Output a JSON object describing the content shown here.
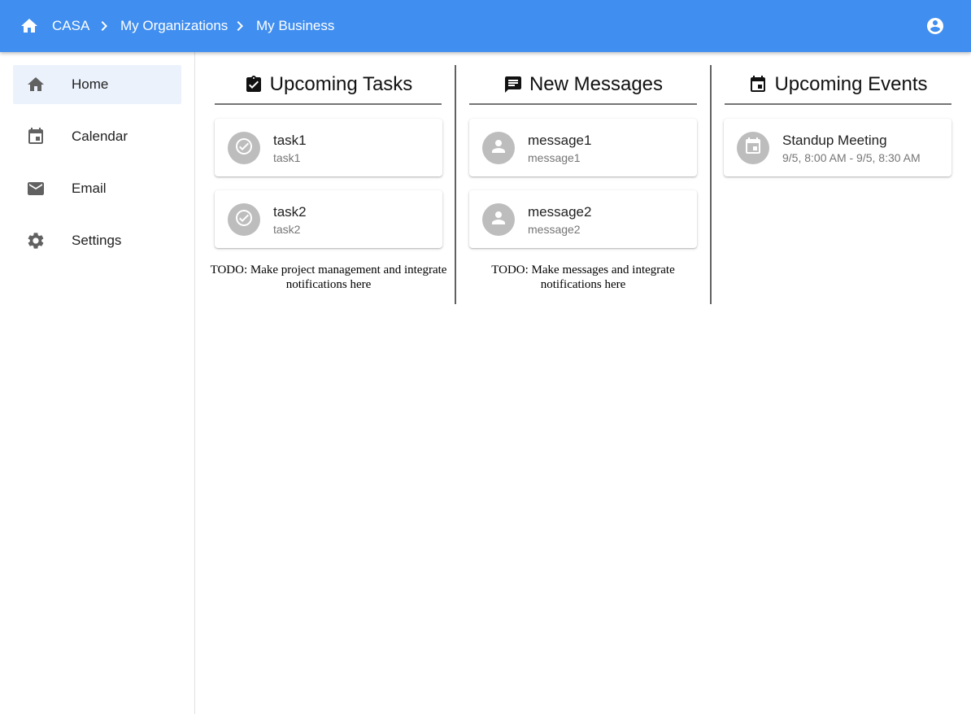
{
  "header": {
    "breadcrumbs": [
      {
        "label": "CASA"
      },
      {
        "label": "My Organizations"
      },
      {
        "label": "My Business"
      }
    ],
    "home_icon": "home-icon",
    "separator_icon": "chevron-right-icon",
    "account_icon": "account-circle-icon",
    "bar_color": "#3f8ef0"
  },
  "sidebar": {
    "items": [
      {
        "label": "Home",
        "icon": "home-icon",
        "active": true
      },
      {
        "label": "Calendar",
        "icon": "calendar-icon",
        "active": false
      },
      {
        "label": "Email",
        "icon": "mail-icon",
        "active": false
      },
      {
        "label": "Settings",
        "icon": "gear-icon",
        "active": false
      }
    ],
    "active_color": "#ecf2fc"
  },
  "tasks": {
    "title": "Upcoming Tasks",
    "icon": "clipboard-check-icon",
    "items": [
      {
        "primary": "task1",
        "secondary": "task1",
        "icon": "check-circle-icon"
      },
      {
        "primary": "task2",
        "secondary": "task2",
        "icon": "check-circle-icon"
      }
    ],
    "todo_line1": "TODO: Make project management and integrate",
    "todo_line2": "notifications here"
  },
  "messages": {
    "title": "New Messages",
    "icon": "message-icon",
    "items": [
      {
        "primary": "message1",
        "secondary": "message1",
        "icon": "person-icon"
      },
      {
        "primary": "message2",
        "secondary": "message2",
        "icon": "person-icon"
      }
    ],
    "todo_line1": "TODO: Make messages and integrate",
    "todo_line2": "notifications here"
  },
  "events": {
    "title": "Upcoming Events",
    "icon": "event-icon",
    "items": [
      {
        "primary": "Standup Meeting",
        "secondary": "9/5, 8:00 AM - 9/5, 8:30 AM",
        "icon": "event-icon"
      }
    ]
  }
}
